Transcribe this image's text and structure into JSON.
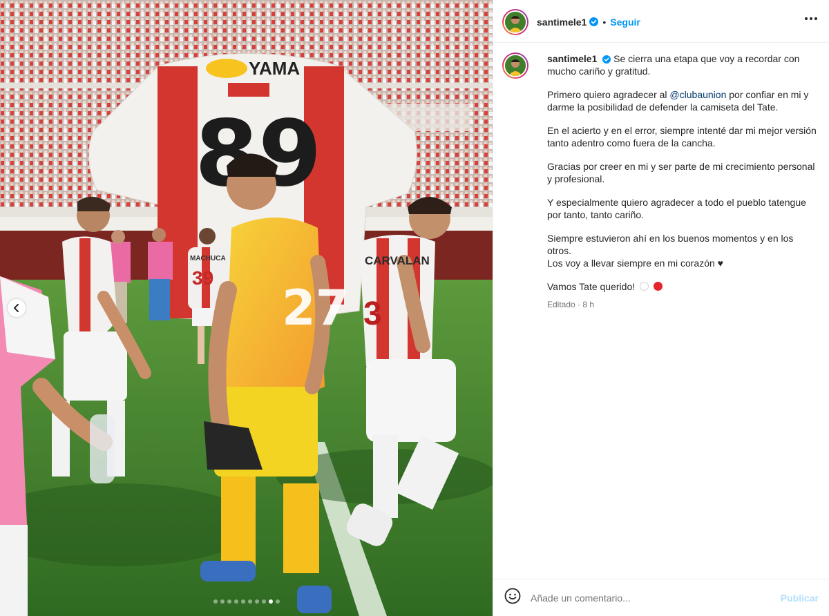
{
  "post": {
    "username": "santimele1",
    "follow_label": "Seguir",
    "separator": "•",
    "caption_lines": [
      "Se cierra una etapa que voy a recordar con mucho cariño y gratitud.",
      "por confiar en mi y darme la posibilidad de defender la camiseta del Tate.",
      "En el acierto y en el error, siempre intenté dar mi mejor versión tanto adentro como fuera de la cancha.",
      "Gracias por creer en mi y ser parte de mi crecimiento personal y profesional.",
      "Y especialmente quiero agradecer a todo el pueblo tatengue por tanto, tanto cariño.",
      "Siempre estuvieron ahí en los buenos momentos y en los otros.",
      "Los voy a llevar siempre en mi corazón ♥",
      "Vamos Tate querido!"
    ],
    "caption_prefix_2": "Primero quiero agradecer al",
    "mention": "@clubaunion",
    "edited_label": "Editado",
    "time_ago": "8 h",
    "meta_separator": "·"
  },
  "photo": {
    "jersey_number": "89",
    "sponsor": "YAMA",
    "player_names": [
      "MACHUCA",
      "CARVALAN"
    ],
    "player_numbers": [
      "39",
      "3"
    ],
    "goalkeeper_number": "27",
    "carousel": {
      "total": 10,
      "active": 9
    }
  },
  "comment": {
    "placeholder": "Añade un comentario...",
    "publish_label": "Publicar"
  },
  "colors": {
    "accent": "#0095f6",
    "union_red": "#d62b2b",
    "goalkeeper_yellow": "#f6c22a",
    "pitch_green": "#3f7f2c"
  }
}
